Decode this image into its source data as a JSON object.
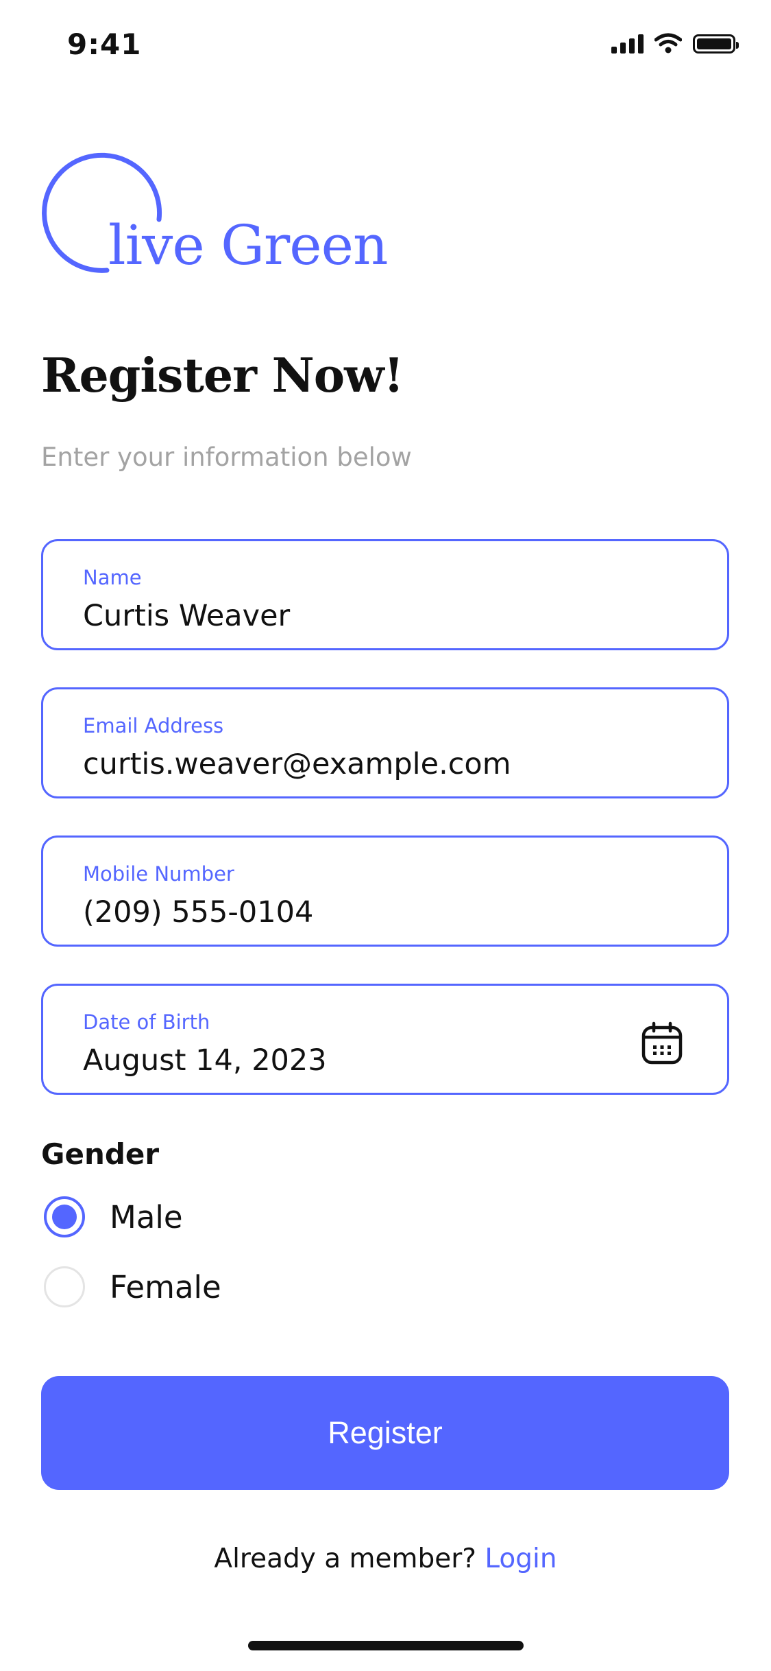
{
  "status_bar": {
    "time": "9:41"
  },
  "brand": {
    "name": "live Green",
    "color": "#5466FF"
  },
  "heading": {
    "title": "Register Now!",
    "subtitle": "Enter your information below"
  },
  "form": {
    "name": {
      "label": "Name",
      "value": "Curtis Weaver"
    },
    "email": {
      "label": "Email Address",
      "value": "curtis.weaver@example.com"
    },
    "mobile": {
      "label": "Mobile Number",
      "value": "(209) 555-0104"
    },
    "dob": {
      "label": "Date of Birth",
      "value": "August 14, 2023",
      "icon": "calendar-icon"
    },
    "gender": {
      "label": "Gender",
      "options": [
        {
          "label": "Male",
          "selected": true
        },
        {
          "label": "Female",
          "selected": false
        }
      ]
    }
  },
  "actions": {
    "register_label": "Register"
  },
  "footer": {
    "prompt": "Already a member?",
    "login_label": "Login"
  }
}
